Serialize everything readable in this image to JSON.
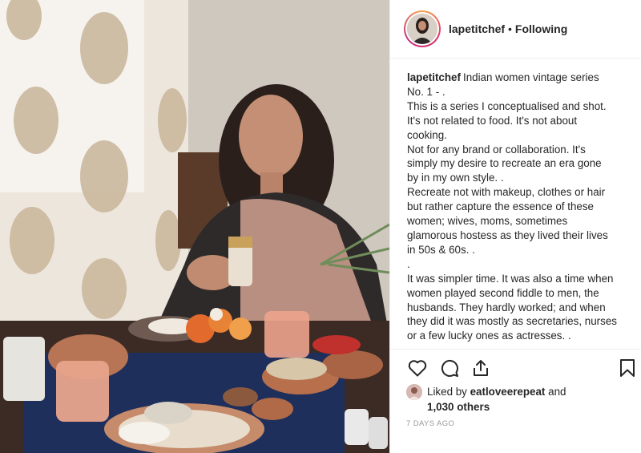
{
  "post": {
    "username": "lapetitchef",
    "header_separator": "•",
    "follow_status": "Following",
    "caption_lines": [
      "Indian women vintage series",
      "No. 1 - .",
      "This is a series I conceptualised and shot.",
      "It's not related to food. It's not about",
      "cooking.",
      "Not for any brand or collaboration. It's",
      "simply my desire to recreate an era gone",
      "by in my own style. .",
      "Recreate not with makeup, clothes or hair",
      "but rather capture the essence of these",
      "women; wives, moms, sometimes",
      "glamorous hostess as they lived their lives",
      "in 50s & 60s. .",
      ".",
      "It was simpler time. It was also a time when",
      "women played second fiddle to men, the",
      "husbands. They hardly worked; and when",
      "they did it was mostly as secretaries, nurses",
      "or a few lucky ones as actresses. ."
    ],
    "likes": {
      "prefix": "Liked by",
      "liker": "eatloveerepeat",
      "connector": "and",
      "others": "1,030 others"
    },
    "timestamp": "7 DAYS AGO"
  },
  "icons": {
    "like": "heart-icon",
    "comment": "comment-icon",
    "share": "share-icon",
    "save": "bookmark-icon"
  },
  "colors": {
    "text": "#262626",
    "muted": "#999999",
    "border": "#efefef",
    "story_ring": "#e1306c"
  }
}
